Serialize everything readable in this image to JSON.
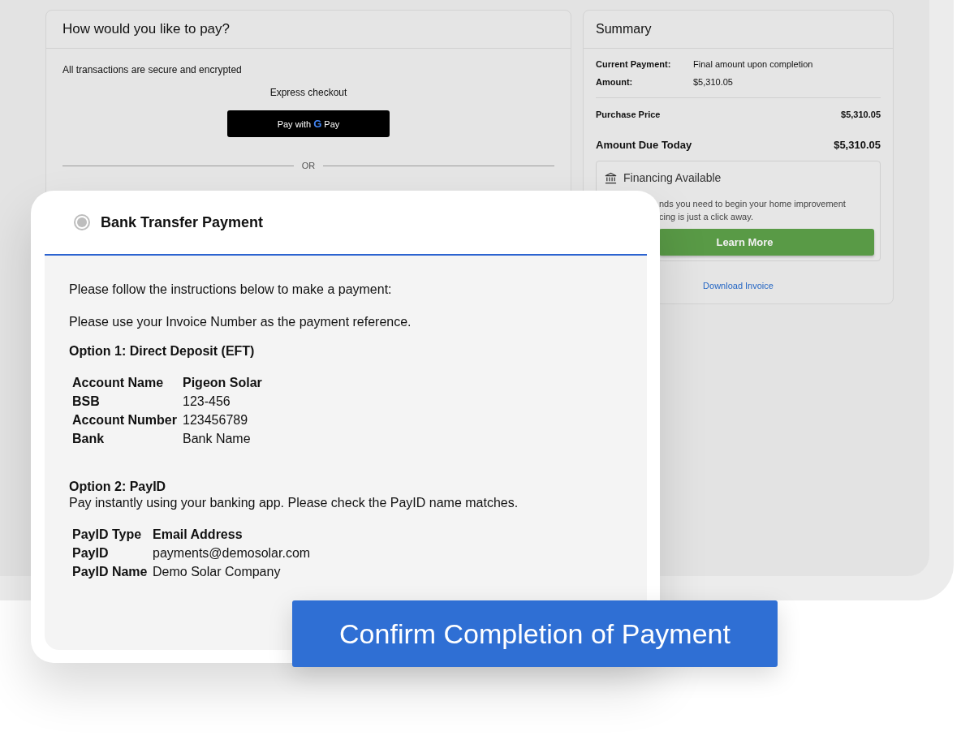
{
  "payment_panel": {
    "title": "How would you like to pay?",
    "security_note": "All transactions are secure and encrypted",
    "express_label": "Express checkout",
    "gpay_button": {
      "prefix": "Pay with",
      "letter": "G",
      "suffix": "Pay"
    },
    "divider_label": "OR"
  },
  "summary": {
    "title": "Summary",
    "details": [
      {
        "label": "Current Payment:",
        "value": "Final amount upon completion"
      },
      {
        "label": "Amount:",
        "value": "$5,310.05"
      }
    ],
    "purchase_price": {
      "label": "Purchase Price",
      "value": "$5,310.05"
    },
    "amount_due": {
      "label": "Amount Due Today",
      "value": "$5,310.05"
    },
    "financing": {
      "title": "Financing Available",
      "description": [
        "nds you need to begin your home improvement",
        "cing is just a click away."
      ],
      "button": "Learn More"
    },
    "download_link": "Download Invoice"
  },
  "bank_transfer": {
    "radio": {
      "label": "Bank Transfer Payment",
      "selected": true
    },
    "intro": "Please follow the instructions below to make a payment:",
    "reference_note": "Please use your Invoice Number as the payment reference.",
    "option_1": {
      "heading": "Option 1: Direct Deposit (EFT)",
      "rows": [
        {
          "label": "Account Name",
          "value": "Pigeon Solar",
          "bold": true
        },
        {
          "label": "BSB",
          "value": "123-456",
          "bold": false
        },
        {
          "label": "Account Number",
          "value": "123456789",
          "bold": false
        },
        {
          "label": "Bank",
          "value": "Bank Name",
          "bold": false
        }
      ]
    },
    "option_2": {
      "heading": "Option 2: PayID",
      "description": "Pay instantly using your banking app. Please check the PayID name matches.",
      "rows": [
        {
          "label": "PayID Type",
          "value": "Email Address",
          "bold": true
        },
        {
          "label": "PayID",
          "value": "payments@demosolar.com",
          "bold": false
        },
        {
          "label": "PayID Name",
          "value": "Demo Solar Company",
          "bold": false
        }
      ]
    }
  },
  "confirm_button": "Confirm Completion of Payment"
}
